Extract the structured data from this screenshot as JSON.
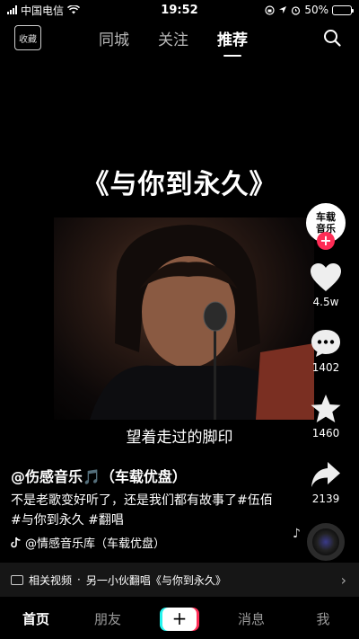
{
  "status_bar": {
    "carrier": "中国电信",
    "time": "19:52",
    "battery_percent": "50%",
    "battery_level": 0.5,
    "battery_color": "#f5c518"
  },
  "top_nav": {
    "collect_label": "收藏",
    "tabs": [
      "同城",
      "关注",
      "推荐"
    ],
    "active_tab": "推荐",
    "search_icon": "search-icon"
  },
  "video": {
    "title": "《与你到永久》",
    "subtitle": "望着走过的脚印"
  },
  "actions": {
    "avatar_text": "车载音乐",
    "like_count": "4.5w",
    "comment_count": "1402",
    "favorite_count": "1460",
    "share_count": "2139",
    "follow_color": "#fe2c55"
  },
  "info": {
    "author": "@伤感音乐🎵（车载优盘）",
    "description": "不是老歌变好听了，还是我们都有故事了#伍佰#与你到永久 #翻唱",
    "music": "@情感音乐库（车载优盘）"
  },
  "related": {
    "label": "相关视频",
    "separator": "·",
    "text": "另一小伙翻唱《与你到永久》"
  },
  "tab_bar": {
    "home": "首页",
    "friends": "朋友",
    "create": "+",
    "messages": "消息",
    "me": "我"
  }
}
